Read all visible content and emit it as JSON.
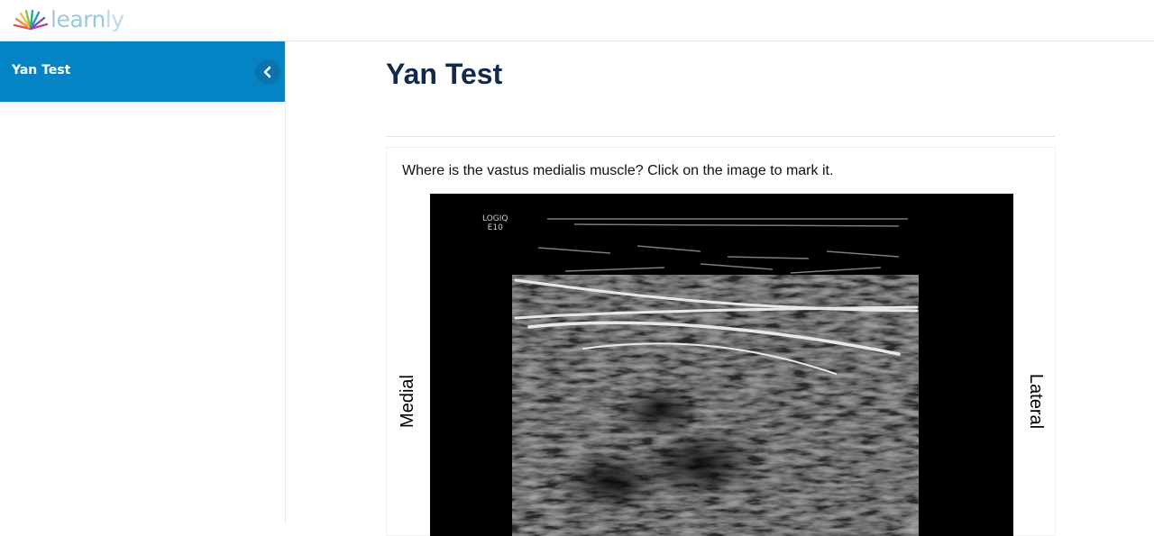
{
  "brand": {
    "logo_text_main": "learn",
    "logo_text_tail": "ly"
  },
  "sidebar": {
    "title": "Yan Test",
    "collapse_icon": "chevron-left-icon"
  },
  "main": {
    "title": "Yan Test",
    "question": "Where is the vastus medialis muscle? Click on the image to mark it.",
    "image": {
      "scanner_line1": "LOGIQ",
      "scanner_line2": "E10",
      "left_label": "Medial",
      "right_label": "Lateral"
    }
  },
  "colors": {
    "sidebar_header": "#0584c5",
    "title": "#13294b",
    "logo": "#9cc7dc"
  }
}
